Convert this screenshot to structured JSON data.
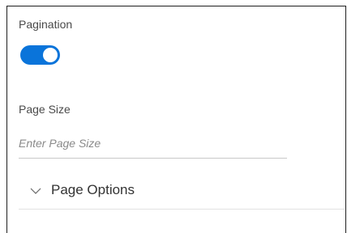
{
  "pagination": {
    "label": "Pagination",
    "enabled": true,
    "toggle_color": "#0a74da"
  },
  "page_size": {
    "label": "Page Size",
    "value": "",
    "placeholder": "Enter Page Size"
  },
  "page_options": {
    "title": "Page Options",
    "expanded": false,
    "icon": "chevron-down-icon"
  }
}
